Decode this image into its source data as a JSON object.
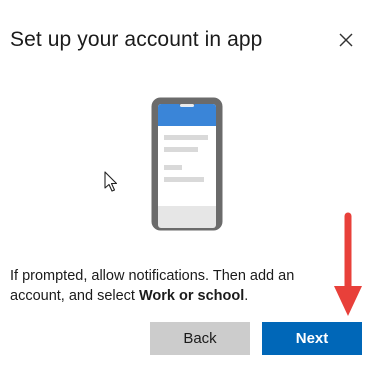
{
  "dialog": {
    "title": "Set up your account in app",
    "message_part1": "If prompted, allow notifications. Then add an account, and select ",
    "message_bold": "Work or school",
    "message_part2": ".",
    "back_label": "Back",
    "next_label": "Next"
  },
  "icons": {
    "close": "close-icon",
    "phone": "phone-illustration",
    "cursor": "mouse-cursor-icon",
    "annotation": "red-arrow-annotation"
  },
  "colors": {
    "primary": "#0067b8",
    "secondary_button": "#cccccc",
    "annotation": "#e8403a",
    "phone_frame": "#6b6b6b",
    "phone_header": "#3a85d8"
  }
}
